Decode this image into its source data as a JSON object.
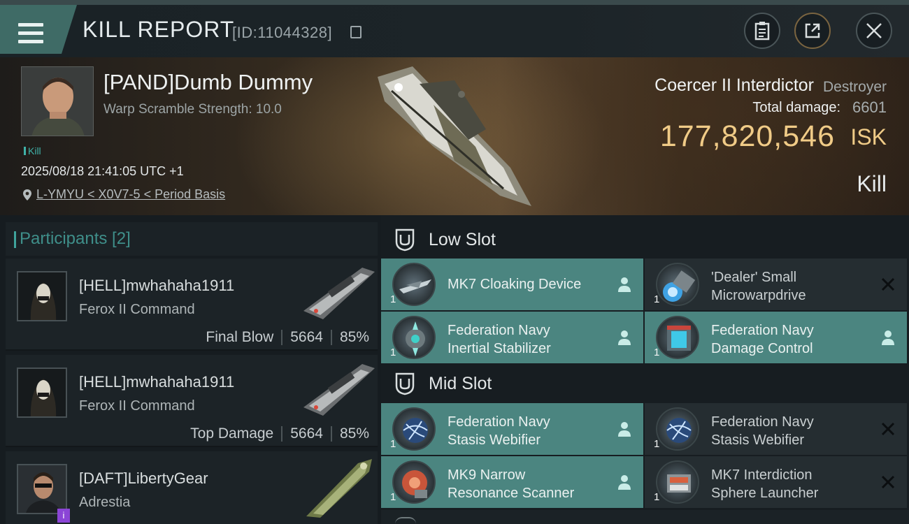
{
  "header": {
    "title": "KILL REPORT",
    "id_text": "[ID:11044328]",
    "buttons": [
      "clipboard",
      "share",
      "close"
    ]
  },
  "victim": {
    "name": "[PAND]Dumb Dummy",
    "subtitle": "Warp Scramble Strength: 10.0",
    "tag": "Kill",
    "datetime": "2025/08/18 21:41:05 UTC +1",
    "location": "L-YMYU < X0V7-5 < Period Basis",
    "ship_name": "Coercer II Interdictor",
    "ship_class": "Destroyer",
    "total_damage_label": "Total damage:",
    "total_damage": "6601",
    "isk_value": "177,820,546",
    "isk_unit": "ISK",
    "result_label": "Kill"
  },
  "participants": {
    "title": "Participants [2]",
    "rows": [
      {
        "name": "[HELL]mwhahaha1911",
        "ship": "Ferox II Command",
        "role": "Final Blow",
        "damage": "5664",
        "percent": "85%"
      },
      {
        "name": "[HELL]mwhahaha1911",
        "ship": "Ferox II Command",
        "role": "Top Damage",
        "damage": "5664",
        "percent": "85%"
      },
      {
        "name": "[DAFT]LibertyGear",
        "ship": "Adrestia",
        "badge": "i"
      }
    ]
  },
  "fitting": {
    "low_slot_title": "Low Slot",
    "mid_slot_title": "Mid Slot",
    "low": [
      {
        "qty": "1",
        "line1": "MK7 Cloaking Device",
        "line2": "",
        "state": "owned-user-icon"
      },
      {
        "qty": "1",
        "line1": "'Dealer' Small",
        "line2": "Microwarpdrive",
        "state": "destroyed-x-icon"
      },
      {
        "qty": "1",
        "line1": "Federation Navy",
        "line2": "Inertial Stabilizer",
        "state": "owned-user-icon"
      },
      {
        "qty": "1",
        "line1": "Federation Navy",
        "line2": "Damage Control",
        "state": "owned-user-icon"
      }
    ],
    "mid": [
      {
        "qty": "1",
        "line1": "Federation Navy",
        "line2": "Stasis Webifier",
        "state": "owned-user-icon"
      },
      {
        "qty": "1",
        "line1": "Federation Navy",
        "line2": "Stasis Webifier",
        "state": "destroyed-x-icon"
      },
      {
        "qty": "1",
        "line1": "MK9 Narrow",
        "line2": "Resonance Scanner",
        "state": "owned-user-icon"
      },
      {
        "qty": "1",
        "line1": "MK7 Interdiction",
        "line2": "Sphere Launcher",
        "state": "destroyed-x-icon"
      }
    ]
  },
  "colors": {
    "accent_teal": "#4b8580",
    "isk_gold": "#f0cb87",
    "participants_title": "#3f8f8a"
  }
}
